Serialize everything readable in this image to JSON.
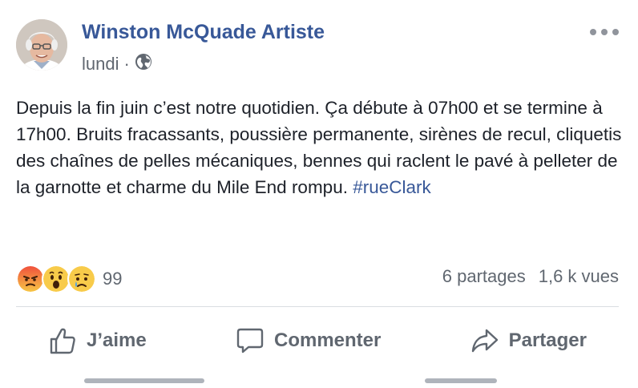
{
  "post": {
    "author": "Winston McQuade Artiste",
    "date": "lundi",
    "separator": "·",
    "privacy_icon": "globe-icon",
    "more_icon": "more-options-icon",
    "text": "Depuis la fin juin c’est notre quotidien. Ça débute à 07h00 et se termine à 17h00. Bruits fracassants, poussière permanente, sirènes de recul, cliquetis des chaînes de pelles mécaniques, bennes qui raclent le pavé à pelleter de la garnotte et charme du Mile End rompu.",
    "hashtag": "#rueClark"
  },
  "reactions": {
    "icons": [
      "angry-reaction-icon",
      "wow-reaction-icon",
      "sad-reaction-icon"
    ],
    "count": "99"
  },
  "stats": {
    "shares": "6 partages",
    "views": "1,6 k vues"
  },
  "actions": {
    "like": "J’aime",
    "comment": "Commenter",
    "share": "Partager"
  },
  "colors": {
    "link": "#385898",
    "secondary": "#606770",
    "text": "#1d2129",
    "divider": "#dadde1"
  }
}
